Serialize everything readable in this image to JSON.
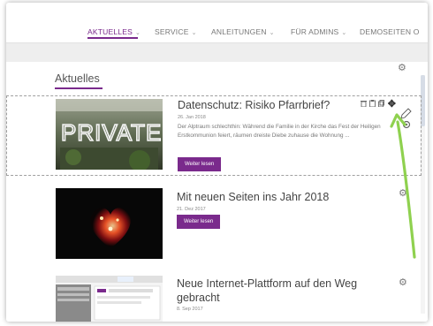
{
  "nav": {
    "items": [
      {
        "label": "AKTUELLES",
        "active": true
      },
      {
        "label": "SERVICE",
        "active": false
      },
      {
        "label": "ANLEITUNGEN",
        "active": false
      },
      {
        "label": "FÜR ADMINS",
        "active": false
      },
      {
        "label": "DEMOSEITEN O",
        "active": false
      }
    ],
    "chevron": "⌄"
  },
  "section": {
    "title": "Aktuelles"
  },
  "articles": [
    {
      "title": "Datenschutz: Risiko Pfarrbrief?",
      "date": "26. Jan 2018",
      "excerpt": "Der Alptraum schlechthin: Während die Familie in der Kirche das Fest der Heiligen Erstkommunion feiert, räumen dreiste Diebe zuhause die Wohnung ...",
      "button": "Weiter lesen",
      "image_text": "PRIVATE"
    },
    {
      "title": "Mit neuen Seiten ins Jahr 2018",
      "date": "21. Dez 2017",
      "button": "Weiter lesen"
    },
    {
      "title": "Neue Internet-Plattform auf den Weg",
      "title_line2": "gebracht",
      "date": "8. Sep 2017"
    }
  ],
  "icons": {
    "gear": "⚙",
    "trash": "🗑",
    "move": "✥"
  },
  "colors": {
    "accent": "#7a2a8c",
    "arrow": "#8fd14f"
  }
}
